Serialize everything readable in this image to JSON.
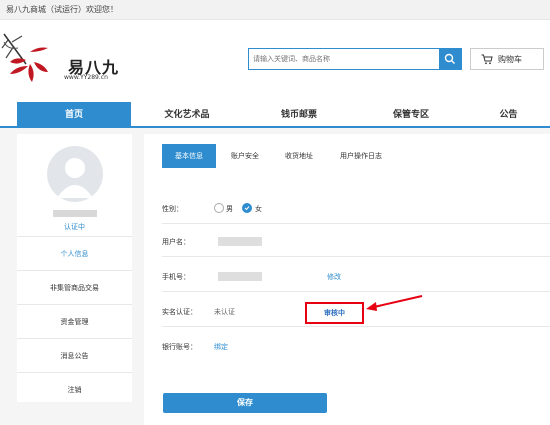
{
  "topbar": {
    "welcome": "易八九商城（试运行）欢迎您！"
  },
  "logo": {
    "name": "易八九",
    "url": "www.YY289.cn"
  },
  "search": {
    "placeholder": "请输入关键词、商品名称",
    "icon": "search-icon"
  },
  "cart": {
    "label": "购物车",
    "icon": "cart-icon"
  },
  "nav": {
    "items": [
      {
        "label": "首页",
        "active": true
      },
      {
        "label": "文化艺术品"
      },
      {
        "label": "钱币邮票"
      },
      {
        "label": "保管专区"
      },
      {
        "label": "公告"
      }
    ]
  },
  "sidebar": {
    "cert_status": "认证中",
    "menu": [
      {
        "label": "个人信息",
        "active": true
      },
      {
        "label": "非集管商品交易"
      },
      {
        "label": "资金管理"
      },
      {
        "label": "消息公告"
      },
      {
        "label": "注销"
      }
    ]
  },
  "tabs": [
    {
      "label": "基本信息",
      "active": true
    },
    {
      "label": "账户安全"
    },
    {
      "label": "收货地址"
    },
    {
      "label": "用户操作日志"
    }
  ],
  "form": {
    "gender": {
      "label": "性别：",
      "male": "男",
      "female": "女",
      "selected": "女"
    },
    "username": {
      "label": "用户名："
    },
    "phone": {
      "label": "手机号：",
      "action": "修改"
    },
    "realname": {
      "label": "实名认证：",
      "status": "未认证",
      "review": "审核中"
    },
    "bank": {
      "label": "银行账号：",
      "action": "绑定"
    }
  },
  "save_button": "保存",
  "colors": {
    "accent": "#2e8ccf",
    "highlight": "#e60012"
  }
}
